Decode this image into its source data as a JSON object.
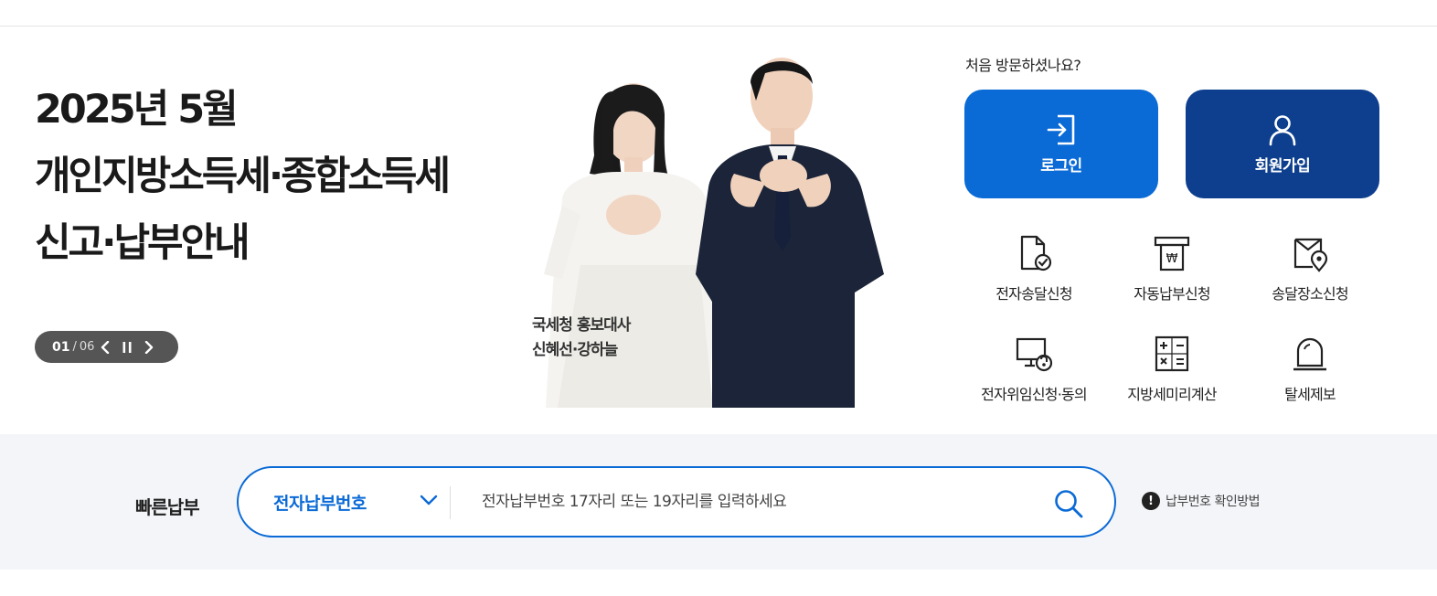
{
  "banner": {
    "headline": [
      "2025년 5월",
      "개인지방소득세·종합소득세",
      "신고·납부안내"
    ],
    "pager": {
      "current": "01",
      "separator": "/",
      "total": "06"
    },
    "caption": [
      "국세청 홍보대사",
      "신혜선·강하늘"
    ]
  },
  "member": {
    "prompt": "처음 방문하셨나요?",
    "login_label": "로그인",
    "join_label": "회원가입"
  },
  "services": [
    {
      "label": "전자송달신청",
      "icon": "document-check-icon"
    },
    {
      "label": "자동납부신청",
      "icon": "auto-payment-icon"
    },
    {
      "label": "송달장소신청",
      "icon": "location-envelope-icon"
    },
    {
      "label": "전자위임신청·동의",
      "icon": "monitor-delegate-icon"
    },
    {
      "label": "지방세미리계산",
      "icon": "calculator-icon"
    },
    {
      "label": "탈세제보",
      "icon": "siren-icon"
    }
  ],
  "quickpay": {
    "label": "빠른납부",
    "select_value": "전자납부번호",
    "input_placeholder": "전자납부번호 17자리 또는 19자리를 입력하세요",
    "help_text": "납부번호 확인방법",
    "help_icon": "!"
  },
  "colors": {
    "primary": "#0a6ad6",
    "navy": "#0d3f8e",
    "pager_bg": "#555555",
    "quick_bg": "#f3f5f8"
  }
}
